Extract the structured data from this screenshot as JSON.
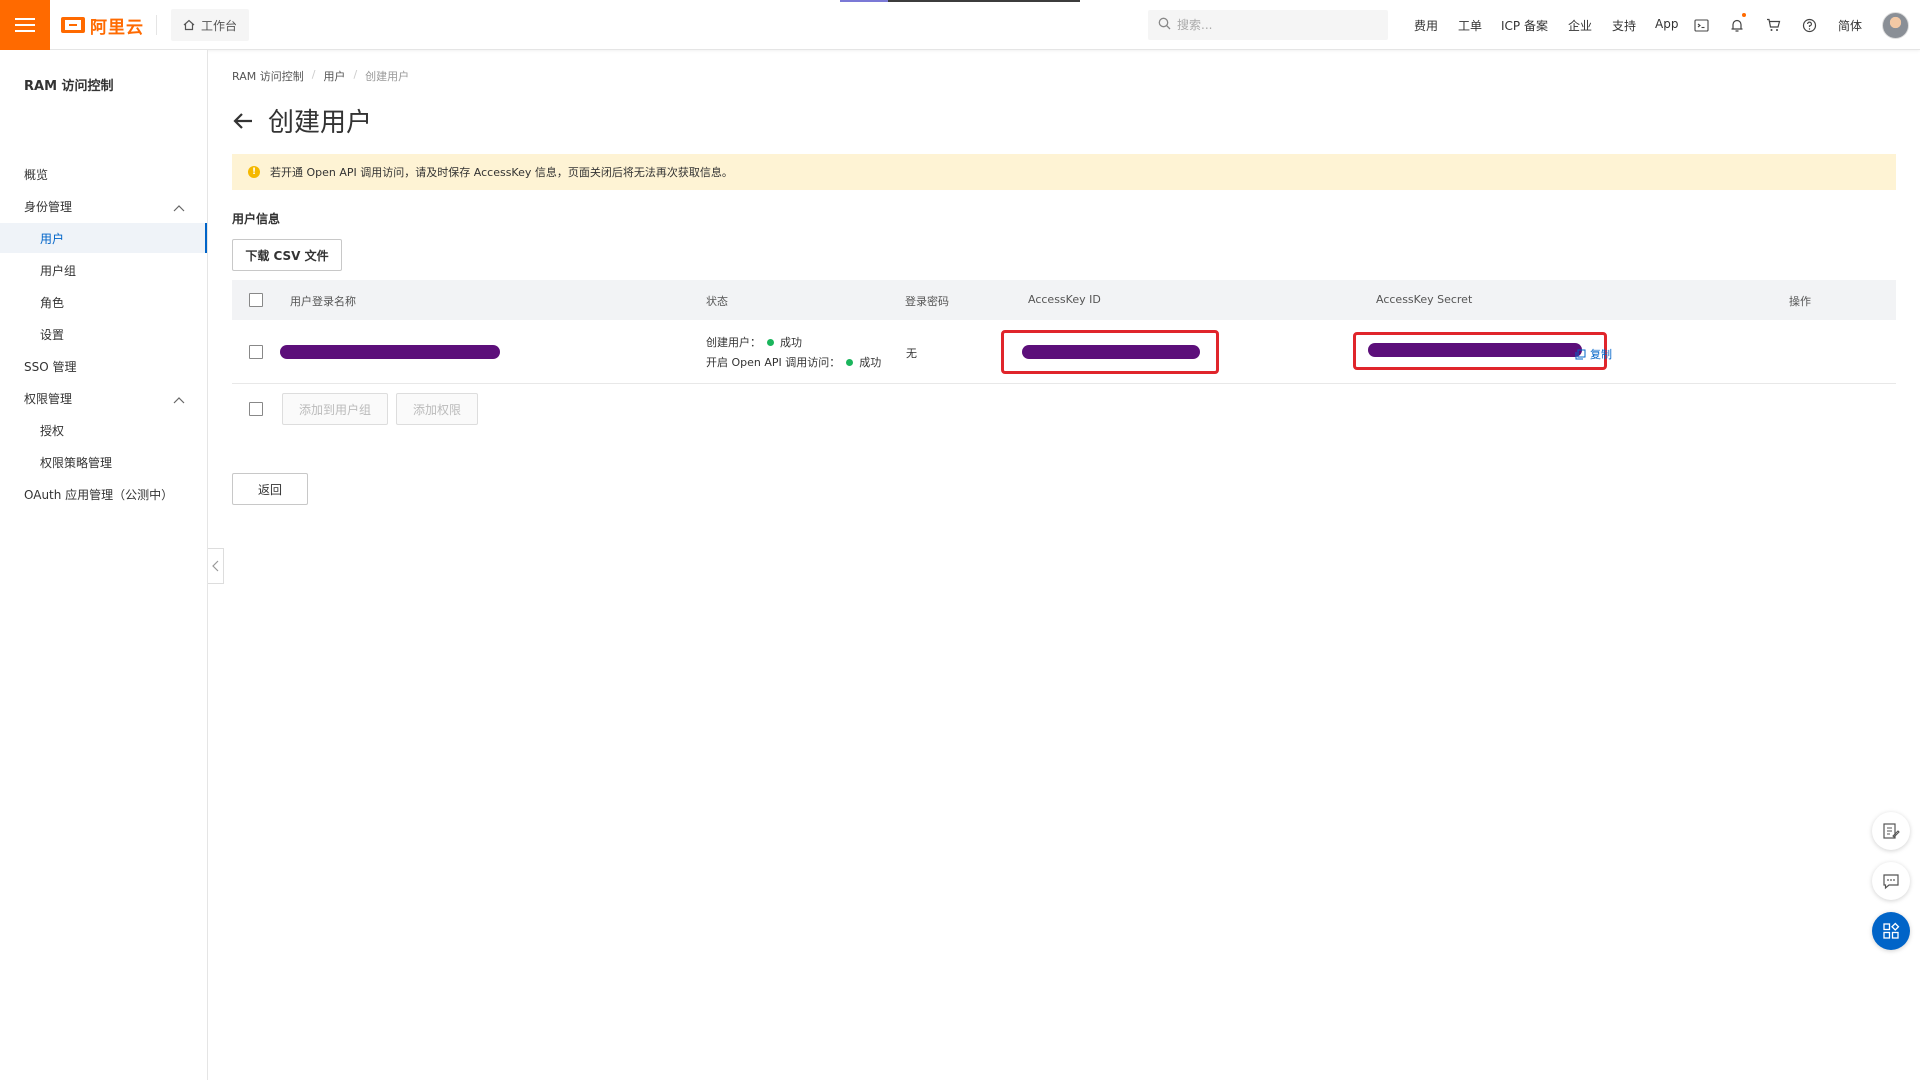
{
  "topbar": {
    "logo_text": "阿里云",
    "workbench_label": "工作台",
    "search_placeholder": "搜索...",
    "nav": [
      "费用",
      "工单",
      "ICP 备案",
      "企业",
      "支持",
      "App"
    ],
    "language": "简体",
    "icons": [
      "terminal-icon",
      "bell-icon",
      "cart-icon",
      "help-icon"
    ]
  },
  "sidebar": {
    "title": "RAM 访问控制",
    "items": [
      {
        "label": "概览"
      },
      {
        "label": "身份管理"
      },
      {
        "label": "用户"
      },
      {
        "label": "用户组"
      },
      {
        "label": "角色"
      },
      {
        "label": "设置"
      },
      {
        "label": "SSO 管理"
      },
      {
        "label": "权限管理"
      },
      {
        "label": "授权"
      },
      {
        "label": "权限策略管理"
      },
      {
        "label": "OAuth 应用管理（公测中）"
      }
    ]
  },
  "breadcrumb": [
    "RAM 访问控制",
    "用户",
    "创建用户"
  ],
  "page_title": "创建用户",
  "notice_text": "若开通 Open API 调用访问，请及时保存 AccessKey 信息，页面关闭后将无法再次获取信息。",
  "section_title": "用户信息",
  "download_csv_label": "下载 CSV 文件",
  "table": {
    "headers": [
      "用户登录名称",
      "状态",
      "登录密码",
      "AccessKey ID",
      "AccessKey Secret",
      "操作"
    ],
    "row": {
      "status_create_label": "创建用户：",
      "status_create_value": "成功",
      "status_api_label": "开启 Open API 调用访问：",
      "status_api_value": "成功",
      "password": "无",
      "action": "复制"
    },
    "footer_buttons": [
      "添加到用户组",
      "添加权限"
    ]
  },
  "back_button_label": "返回",
  "colors": {
    "brand": "#ff6a00",
    "primary": "#0064c8",
    "success": "#1ab55c",
    "warning_bg": "#fef3d4",
    "annotation_red": "#e0252b",
    "redaction": "#5c0f7a"
  }
}
